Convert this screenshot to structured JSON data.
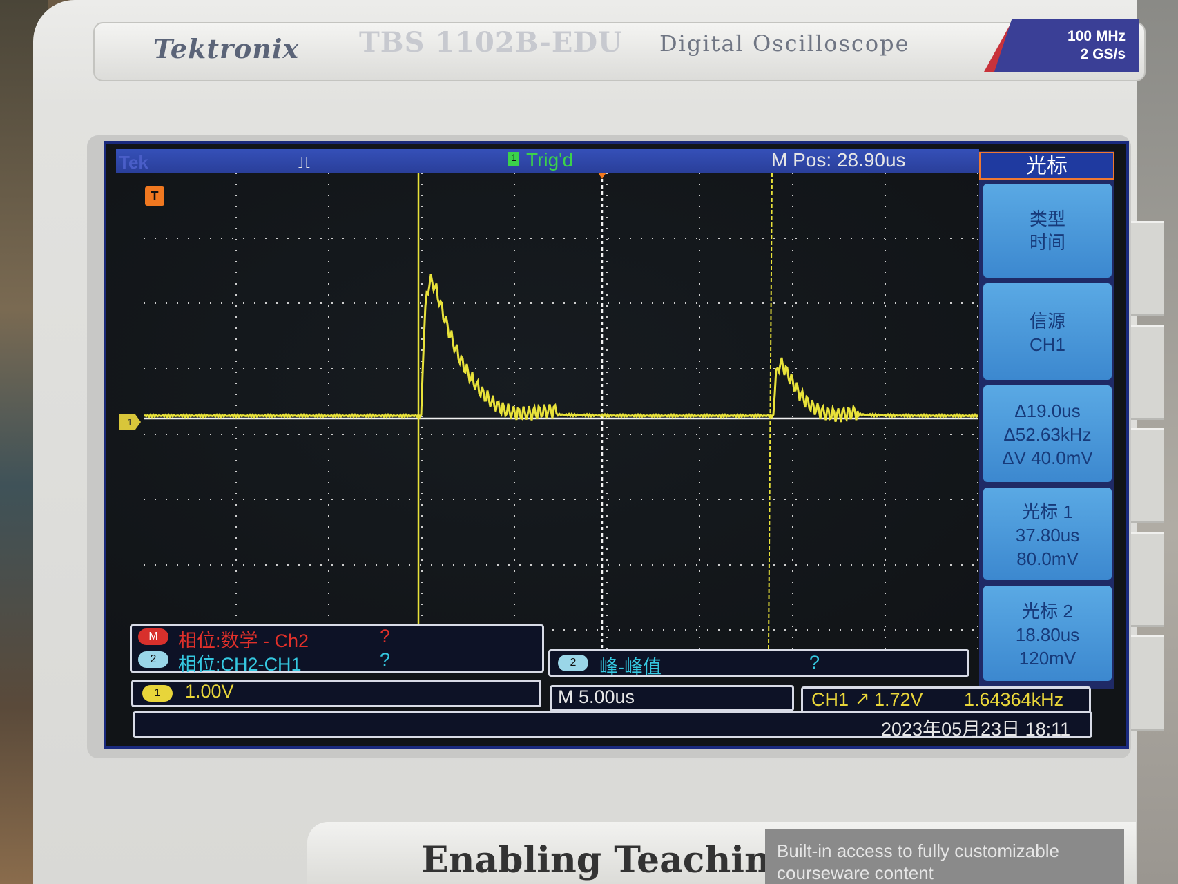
{
  "device": {
    "brand": "Tektronix",
    "model": "TBS 1102B-EDU",
    "description": "Digital Oscilloscope",
    "spec_line1": "100 MHz",
    "spec_line2": "2 GS/s"
  },
  "status_bar": {
    "tek": "Tek",
    "acq_icon": "acquire-run-icon",
    "trigger_state": "Trig'd",
    "trigger_box": "1",
    "horizontal_position": "M Pos: 28.90us"
  },
  "markers": {
    "trigger_position": "T",
    "channel1_ground": "1"
  },
  "menu": {
    "title": "光标",
    "buttons": [
      {
        "lines": [
          "类型",
          "时间"
        ]
      },
      {
        "lines": [
          "信源",
          "CH1"
        ]
      },
      {
        "lines": [
          "Δ19.0us",
          "Δ52.63kHz",
          "ΔV 40.0mV"
        ]
      },
      {
        "lines": [
          "光标 1",
          "37.80us",
          "80.0mV"
        ]
      },
      {
        "lines": [
          "光标 2",
          "18.80us",
          "120mV"
        ]
      }
    ]
  },
  "measurements": {
    "math_chip": "M",
    "math_label": "相位:数学 - Ch2",
    "math_value": "?",
    "ch2_chip": "2",
    "ch2_label": "相位:CH2-CH1",
    "ch2_value": "?",
    "pk_chip": "2",
    "pk_label": "峰-峰值",
    "pk_value": "?"
  },
  "readouts": {
    "ch1_chip": "1",
    "ch1_scale": "1.00V",
    "timebase": "M 5.00us",
    "trigger_source": "CH1",
    "trigger_slope_icon": "rising-edge-icon",
    "trigger_level": "1.72V",
    "frequency": "1.64364kHz",
    "datetime": "2023年05月23日 18:11"
  },
  "lower_panel": {
    "title": "Enabling Teaching",
    "desc_line1": "Built-in access to fully customizable",
    "desc_line2": "courseware content"
  },
  "colors": {
    "trace": "#e8e23a",
    "cursor": "#e8e23a",
    "grid": "#cfcfcf",
    "topbar": "#2f47a8",
    "menu_button": "#4a99da",
    "math_red": "#e0302a",
    "ch2_cyan": "#35c8e0",
    "ch1_yellow": "#e8d53a"
  }
}
